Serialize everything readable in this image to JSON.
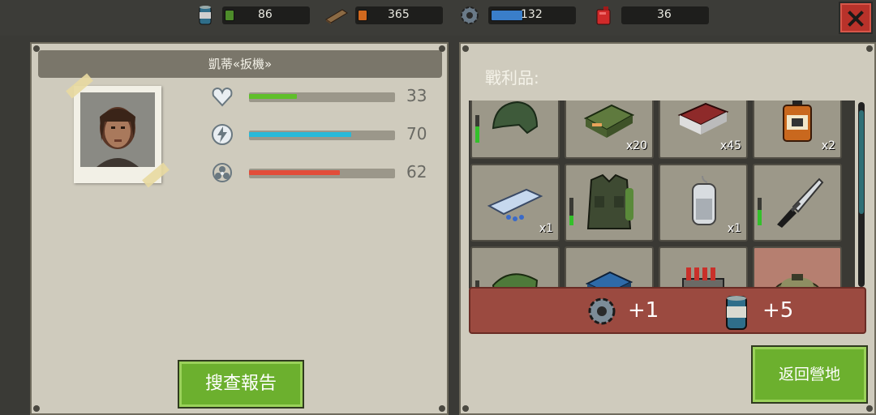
{
  "resources": [
    {
      "name": "food",
      "icon": "can-icon",
      "value": "86",
      "fill_color": "#4d8c2a",
      "fill_fraction": 0.1
    },
    {
      "name": "wood",
      "icon": "wood-plank-icon",
      "value": "365",
      "fill_color": "#d2691e",
      "fill_fraction": 0.03
    },
    {
      "name": "parts",
      "icon": "gear-icon",
      "value": "132",
      "fill_color": "#3a7ec9",
      "fill_fraction": 0.4
    },
    {
      "name": "fuel",
      "icon": "fuel-can-icon",
      "value": "36",
      "fill_color": "",
      "fill_fraction": 0
    }
  ],
  "character": {
    "name": "凱蒂«扳機»",
    "stats": [
      {
        "name": "health",
        "icon": "heart-icon",
        "value": "33",
        "fraction": 0.33,
        "color": "#5fbf2a"
      },
      {
        "name": "energy",
        "icon": "lightning-icon",
        "value": "70",
        "fraction": 0.7,
        "color": "#28b9d9"
      },
      {
        "name": "radiation",
        "icon": "biohazard-icon",
        "value": "62",
        "fraction": 0.62,
        "color": "#e24d3a"
      }
    ]
  },
  "buttons": {
    "search_report": "搜查報告",
    "return_camp": "返回營地"
  },
  "loot": {
    "label": "戰利品:",
    "rows": [
      [
        {
          "name": "helmet-icon",
          "qty": "",
          "durability": 0.6
        },
        {
          "name": "ammo-box-icon",
          "qty": "x20",
          "durability": null
        },
        {
          "name": "shotgun-shells-icon",
          "qty": "x45",
          "durability": null
        },
        {
          "name": "whiskey-bottle-icon",
          "qty": "x2",
          "durability": null
        }
      ],
      [
        {
          "name": "pills-icon",
          "qty": "x1",
          "durability": null
        },
        {
          "name": "armor-vest-icon",
          "qty": "",
          "durability": 0.35
        },
        {
          "name": "iv-bag-icon",
          "qty": "x1",
          "durability": null
        },
        {
          "name": "combat-knife-icon",
          "qty": "",
          "durability": 0.55
        }
      ],
      [
        {
          "name": "cloth-icon",
          "qty": "",
          "durability": 0.3
        },
        {
          "name": "blue-crate-icon",
          "qty": "",
          "durability": null
        },
        {
          "name": "ammo-belt-icon",
          "qty": "",
          "durability": null
        },
        {
          "name": "landmine-icon",
          "qty": "",
          "durability": null
        }
      ]
    ]
  },
  "rewards": [
    {
      "name": "parts",
      "icon": "gear-icon",
      "value": "+1"
    },
    {
      "name": "food",
      "icon": "can-icon",
      "value": "+5"
    }
  ],
  "scroll_position": 0.1
}
